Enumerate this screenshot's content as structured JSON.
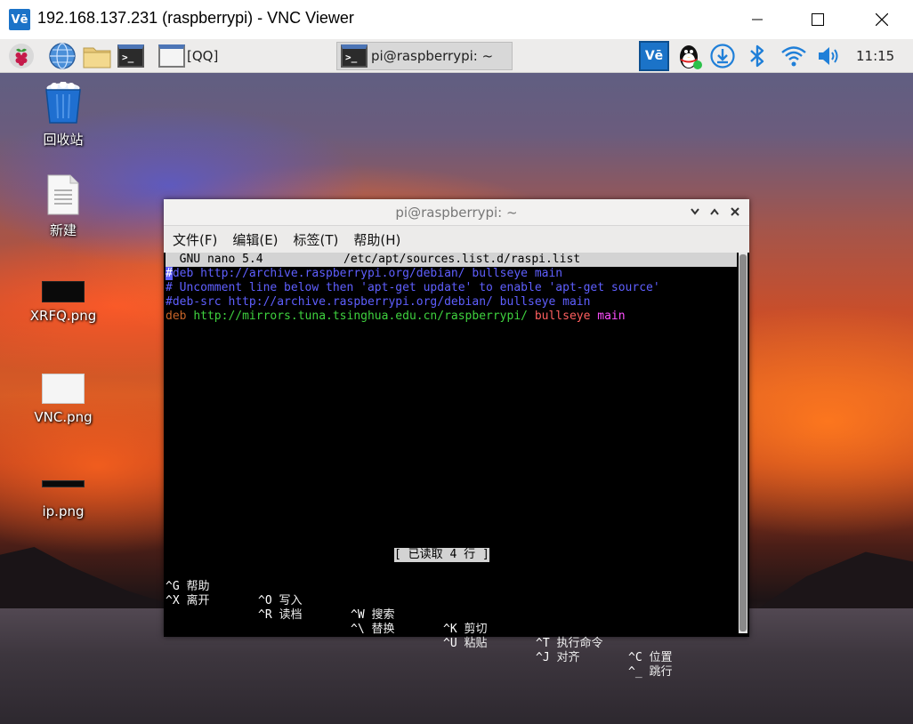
{
  "window": {
    "title": "192.168.137.231 (raspberrypi) - VNC Viewer",
    "app_icon_text": "Vē"
  },
  "panel": {
    "qq_label": "[QQ]",
    "terminal_task_label": "pi@raspberrypi: ~",
    "clock": "11:15"
  },
  "desktop_icons": [
    {
      "label": "回收站",
      "icon": "trash-icon"
    },
    {
      "label": "新建",
      "icon": "document-icon"
    },
    {
      "label": "XRFQ.png",
      "icon": "image-thumbnail-icon"
    },
    {
      "label": "VNC.png",
      "icon": "image-thumbnail-icon"
    },
    {
      "label": "ip.png",
      "icon": "image-thumbnail-icon"
    }
  ],
  "terminal": {
    "title": "pi@raspberrypi: ~",
    "menu": [
      "文件(F)",
      "编辑(E)",
      "标签(T)",
      "帮助(H)"
    ],
    "nano": {
      "version": "  GNU nano 5.4",
      "filename": "/etc/apt/sources.list.d/raspi.list",
      "line1_cursor": "#",
      "line1_rest": "deb http://archive.raspberrypi.org/debian/ bullseye main",
      "line2": "# Uncomment line below then 'apt-get update' to enable 'apt-get source'",
      "line3": "#deb-src http://archive.raspberrypi.org/debian/ bullseye main",
      "line4_deb": "deb",
      "line4_url": "http://mirrors.tuna.tsinghua.edu.cn/raspberrypi/",
      "line4_suite": "bullseye",
      "line4_comp": "main",
      "status": "[ 已读取 4 行 ]",
      "shortcuts_row1": [
        {
          "key": "^G",
          "desc": "帮助"
        },
        {
          "key": "^O",
          "desc": "写入"
        },
        {
          "key": "^W",
          "desc": "搜索"
        },
        {
          "key": "^K",
          "desc": "剪切"
        },
        {
          "key": "^T",
          "desc": "执行命令"
        },
        {
          "key": "^C",
          "desc": "位置"
        }
      ],
      "shortcuts_row2": [
        {
          "key": "^X",
          "desc": "离开"
        },
        {
          "key": "^R",
          "desc": "读档"
        },
        {
          "key": "^\\",
          "desc": "替换"
        },
        {
          "key": "^U",
          "desc": "粘贴"
        },
        {
          "key": "^J",
          "desc": "对齐"
        },
        {
          "key": "^_",
          "desc": "跳行"
        }
      ]
    }
  },
  "colors": {
    "comment": "#5f5fff",
    "deb_keyword": "#c86428",
    "url": "#3fd23f",
    "suite": "#ff5f5f",
    "component": "#ff4fff"
  }
}
